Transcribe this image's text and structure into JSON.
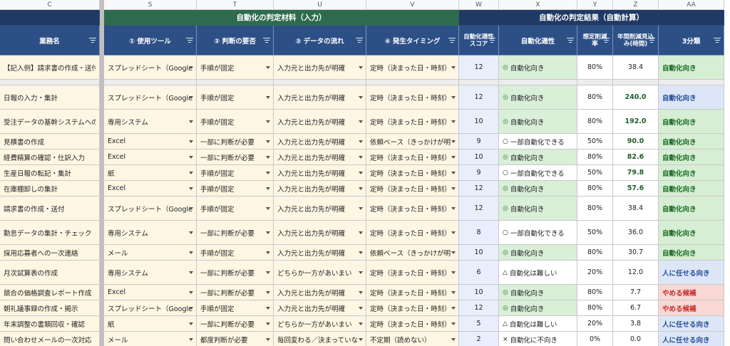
{
  "columns": [
    "C",
    "S",
    "T",
    "U",
    "V",
    "W",
    "X",
    "Y",
    "Z",
    "AA"
  ],
  "groups": {
    "input_title": "自動化の判定材料（入力）",
    "result_title": "自動化の判定結果（自動計算）"
  },
  "headers": {
    "task": "業務名",
    "tool": "① 使用ツール",
    "judge": "② 判断の要否",
    "flow": "③ データの流れ",
    "timing": "④ 発生タイミング",
    "score": "自動化適性スコア",
    "fit": "自動化適性",
    "rate": "想定削減率",
    "hours": "年間削減見込み(時間)",
    "class": "3分類"
  },
  "colors": {
    "header": "#2c4f86",
    "input_group": "#2e6b4e",
    "result_group": "#1f3a64"
  },
  "example": {
    "task": "【記入例】請求書の作成・送付",
    "tool": "スプレッドシート（Google",
    "judge": "手順が固定",
    "flow": "入力元と出力先が明確",
    "timing": "定時（決まった日・時刻）",
    "score": "12",
    "fit_icon": "◎",
    "fit": "自動化向き",
    "rate": "80%",
    "hours": "38.4",
    "class": "自動化向き",
    "tone": "green"
  },
  "rows": [
    {
      "task": "日報の入力・集計",
      "tool": "スプレッドシート（Google",
      "judge": "手順が固定",
      "flow": "入力元と出力先が明確",
      "timing": "定時（決まった日・時刻）",
      "score": "12",
      "fit_icon": "◎",
      "fit": "自動化向き",
      "rate": "80%",
      "hours": "240.0",
      "bold": true,
      "class": "自動化向き",
      "tone": "blue"
    },
    {
      "task": "受注データの基幹システムへの転",
      "tool": "専用システム",
      "judge": "手順が固定",
      "flow": "入力元と出力先が明確",
      "timing": "定時（決まった日・時刻）",
      "score": "10",
      "fit_icon": "◎",
      "fit": "自動化向き",
      "rate": "80%",
      "hours": "192.0",
      "bold": true,
      "class": "自動化向き",
      "tone": "green"
    },
    {
      "task": "見積書の作成",
      "tool": "Excel",
      "judge": "一部に判断が必要",
      "flow": "入力元と出力先が明確",
      "timing": "依頼ベース（きっかけが明",
      "score": "9",
      "fit_icon": "○",
      "fit": "一部自動化できる",
      "rate": "50%",
      "hours": "90.0",
      "bold": true,
      "class": "自動化向き",
      "tone": "green"
    },
    {
      "task": "経費精算の確認・仕訳入力",
      "tool": "Excel",
      "judge": "一部に判断が必要",
      "flow": "入力元と出力先が明確",
      "timing": "定時（決まった日・時刻）",
      "score": "10",
      "fit_icon": "◎",
      "fit": "自動化向き",
      "rate": "80%",
      "hours": "82.6",
      "bold": true,
      "class": "自動化向き",
      "tone": "green"
    },
    {
      "task": "生産日報の転記・集計",
      "tool": "紙",
      "judge": "手順が固定",
      "flow": "入力元と出力先が明確",
      "timing": "定時（決まった日・時刻）",
      "score": "9",
      "fit_icon": "○",
      "fit": "一部自動化できる",
      "rate": "50%",
      "hours": "79.8",
      "bold": true,
      "class": "自動化向き",
      "tone": "green"
    },
    {
      "task": "在庫棚卸しの集計",
      "tool": "Excel",
      "judge": "手順が固定",
      "flow": "入力元と出力先が明確",
      "timing": "定時（決まった日・時刻）",
      "score": "12",
      "fit_icon": "◎",
      "fit": "自動化向き",
      "rate": "80%",
      "hours": "57.6",
      "bold": true,
      "class": "自動化向き",
      "tone": "green"
    },
    {
      "task": "請求書の作成・送付",
      "tool": "スプレッドシート（Google",
      "judge": "手順が固定",
      "flow": "入力元と出力先が明確",
      "timing": "定時（決まった日・時刻）",
      "score": "12",
      "fit_icon": "◎",
      "fit": "自動化向き",
      "rate": "80%",
      "hours": "38.4",
      "bold": false,
      "class": "自動化向き",
      "tone": "green"
    },
    {
      "task": "勤怠データの集計・チェック",
      "tool": "専用システム",
      "judge": "一部に判断が必要",
      "flow": "入力元と出力先が明確",
      "timing": "定時（決まった日・時刻）",
      "score": "8",
      "fit_icon": "○",
      "fit": "一部自動化できる",
      "rate": "50%",
      "hours": "36.0",
      "bold": false,
      "class": "自動化向き",
      "tone": "green"
    },
    {
      "task": "採用応募者への一次連絡",
      "tool": "メール",
      "judge": "手順が固定",
      "flow": "入力元と出力先が明確",
      "timing": "依頼ベース（きっかけが明",
      "score": "10",
      "fit_icon": "◎",
      "fit": "自動化向き",
      "rate": "80%",
      "hours": "30.7",
      "bold": false,
      "class": "自動化向き",
      "tone": "green"
    },
    {
      "task": "月次試算表の作成",
      "tool": "専用システム",
      "judge": "一部に判断が必要",
      "flow": "どちらか一方があいまい",
      "timing": "定時（決まった日・時刻）",
      "score": "6",
      "fit_icon": "△",
      "fit": "自動化は難しい",
      "rate": "20%",
      "hours": "12.0",
      "bold": false,
      "class": "人に任せる向き",
      "tone": "blue"
    },
    {
      "task": "競合の価格調査レポート作成",
      "tool": "Excel",
      "judge": "一部に判断が必要",
      "flow": "入力元と出力先が明確",
      "timing": "定時（決まった日・時刻）",
      "score": "10",
      "fit_icon": "◎",
      "fit": "自動化向き",
      "rate": "80%",
      "hours": "7.7",
      "bold": false,
      "class": "やめる候補",
      "tone": "red"
    },
    {
      "task": "朝礼議事録の作成・掲示",
      "tool": "スプレッドシート（Google",
      "judge": "手順が固定",
      "flow": "入力元と出力先が明確",
      "timing": "定時（決まった日・時刻）",
      "score": "12",
      "fit_icon": "◎",
      "fit": "自動化向き",
      "rate": "80%",
      "hours": "6.7",
      "bold": false,
      "class": "やめる候補",
      "tone": "red"
    },
    {
      "task": "年末調整の書類回収・確認",
      "tool": "紙",
      "judge": "一部に判断が必要",
      "flow": "どちらか一方があいまい",
      "timing": "定時（決まった日・時刻）",
      "score": "5",
      "fit_icon": "△",
      "fit": "自動化は難しい",
      "rate": "20%",
      "hours": "3.8",
      "bold": false,
      "class": "人に任せる向き",
      "tone": "blue"
    },
    {
      "task": "問い合わせメールの一次対応",
      "tool": "メール",
      "judge": "都度判断が必要",
      "flow": "毎回変わる／決まっていな",
      "timing": "不定期（読めない）",
      "score": "2",
      "fit_icon": "×",
      "fit": "自動化に不向き",
      "rate": "0%",
      "hours": "0.0",
      "bold": false,
      "class": "人に任せる向き",
      "tone": "blue"
    }
  ]
}
